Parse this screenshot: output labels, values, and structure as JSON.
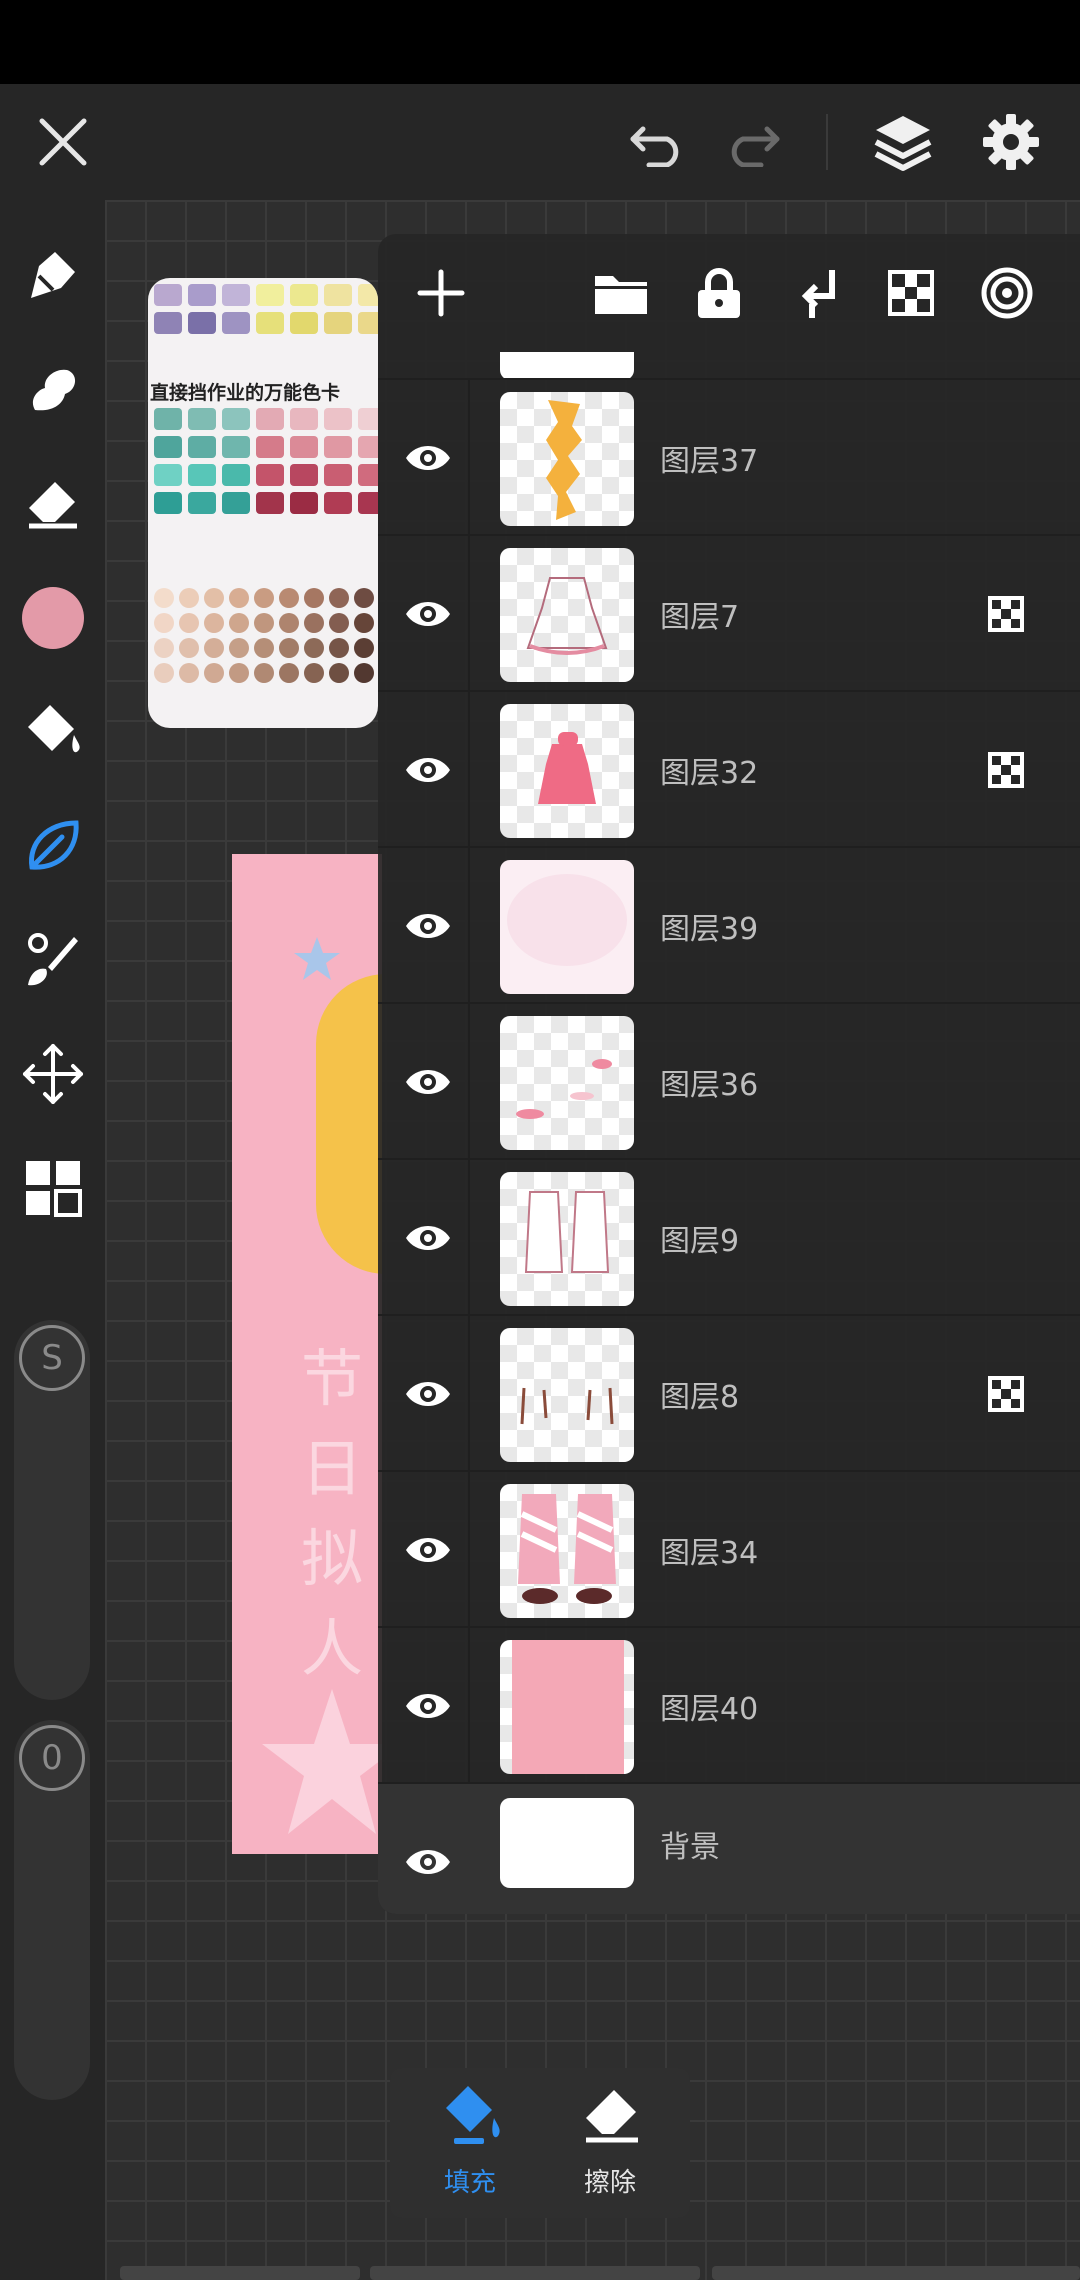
{
  "colors": {
    "accent": "#2f8ff0",
    "current_color": "#e39aa8",
    "panel_bg": "#262626"
  },
  "top_bar": {
    "close_icon": "close-icon",
    "undo_icon": "undo-icon",
    "redo_icon": "redo-icon",
    "layers_icon": "layers-icon",
    "settings_icon": "gear-icon"
  },
  "left_toolbar": {
    "tools": [
      "pencil",
      "smudge",
      "eraser",
      "color",
      "fill-bucket",
      "leaf-brush",
      "brush-size",
      "transform",
      "gallery"
    ],
    "active_tool": "leaf-brush",
    "size_slider_label": "S",
    "opacity_slider_label": "0"
  },
  "reference_image": {
    "title": "直接挡作业的万能色卡"
  },
  "artwork": {
    "text": "节日拟人"
  },
  "layers_panel": {
    "toolbar_icons": [
      "add-icon",
      "folder-icon",
      "lock-icon",
      "merge-down-icon",
      "alpha-lock-icon",
      "target-icon"
    ],
    "layers": [
      {
        "name": "图层37",
        "clipping": false,
        "thumb": "orange-strip"
      },
      {
        "name": "图层7",
        "clipping": true,
        "thumb": "dress-outline"
      },
      {
        "name": "图层32",
        "clipping": true,
        "thumb": "red-dress"
      },
      {
        "name": "图层39",
        "clipping": false,
        "thumb": "pink-cloud"
      },
      {
        "name": "图层36",
        "clipping": false,
        "thumb": "pink-bits"
      },
      {
        "name": "图层9",
        "clipping": false,
        "thumb": "sleeves"
      },
      {
        "name": "图层8",
        "clipping": true,
        "thumb": "lines"
      },
      {
        "name": "图层34",
        "clipping": false,
        "thumb": "stockings"
      },
      {
        "name": "图层40",
        "clipping": false,
        "thumb": "pink-fill"
      }
    ],
    "background_layer": {
      "name": "背景"
    }
  },
  "bottom_popup": {
    "fill_label": "填充",
    "erase_label": "擦除"
  }
}
